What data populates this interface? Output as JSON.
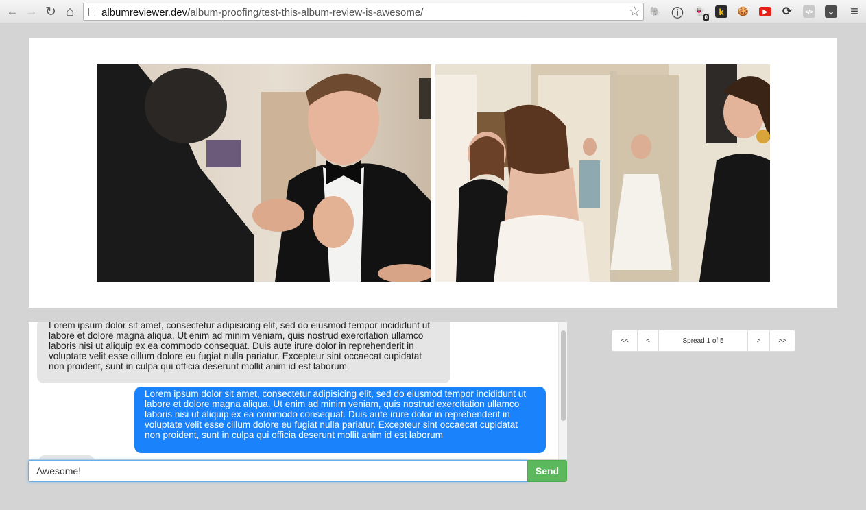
{
  "browser": {
    "url_host": "albumreviewer.dev",
    "url_path": "/album-proofing/test-this-album-review-is-awesome/",
    "back_glyph": "←",
    "forward_glyph": "→",
    "reload_glyph": "↻",
    "home_glyph": "⌂",
    "star_glyph": "☆",
    "menu_glyph": "≡",
    "extensions": [
      {
        "name": "evernote-icon",
        "glyph": "🐘"
      },
      {
        "name": "onepassword-icon",
        "glyph": "ⓘ"
      },
      {
        "name": "ghostery-icon",
        "glyph": "👻",
        "badge": "0"
      },
      {
        "name": "kippt-icon",
        "glyph": "k"
      },
      {
        "name": "cookie-icon",
        "glyph": "🍪"
      },
      {
        "name": "youtube-icon",
        "glyph": "▶"
      },
      {
        "name": "sync-icon",
        "glyph": "⟳"
      },
      {
        "name": "code-icon",
        "glyph": "</>"
      },
      {
        "name": "pocket-icon",
        "glyph": "⌄"
      }
    ]
  },
  "chat": {
    "messages": [
      {
        "side": "received",
        "text": "Lorem ipsum dolor sit amet, consectetur adipisicing elit, sed do eiusmod tempor incididunt ut labore et dolore magna aliqua. Ut enim ad minim veniam, quis nostrud exercitation ullamco laboris nisi ut aliquip ex ea commodo consequat. Duis aute irure dolor in reprehenderit in voluptate velit esse cillum dolore eu fugiat nulla pariatur. Excepteur sint occaecat cupidatat non proident, sunt in culpa qui officia deserunt mollit anim id est laborum"
      },
      {
        "side": "sent",
        "text": "Lorem ipsum dolor sit amet, consectetur adipisicing elit, sed do eiusmod tempor incididunt ut labore et dolore magna aliqua. Ut enim ad minim veniam, quis nostrud exercitation ullamco laboris nisi ut aliquip ex ea commodo consequat. Duis aute irure dolor in reprehenderit in voluptate velit esse cillum dolore eu fugiat nulla pariatur. Excepteur sint occaecat cupidatat non proident, sunt in culpa qui officia deserunt mollit anim id est laborum"
      }
    ],
    "input_value": "Awesome!",
    "send_label": "Send"
  },
  "pager": {
    "first_label": "<<",
    "prev_label": "<",
    "status": "Spread 1 of 5",
    "next_label": ">",
    "last_label": ">>"
  },
  "colors": {
    "sent_bubble": "#1a82fb",
    "received_bubble": "#e5e5e5",
    "send_button": "#5cb85c"
  }
}
